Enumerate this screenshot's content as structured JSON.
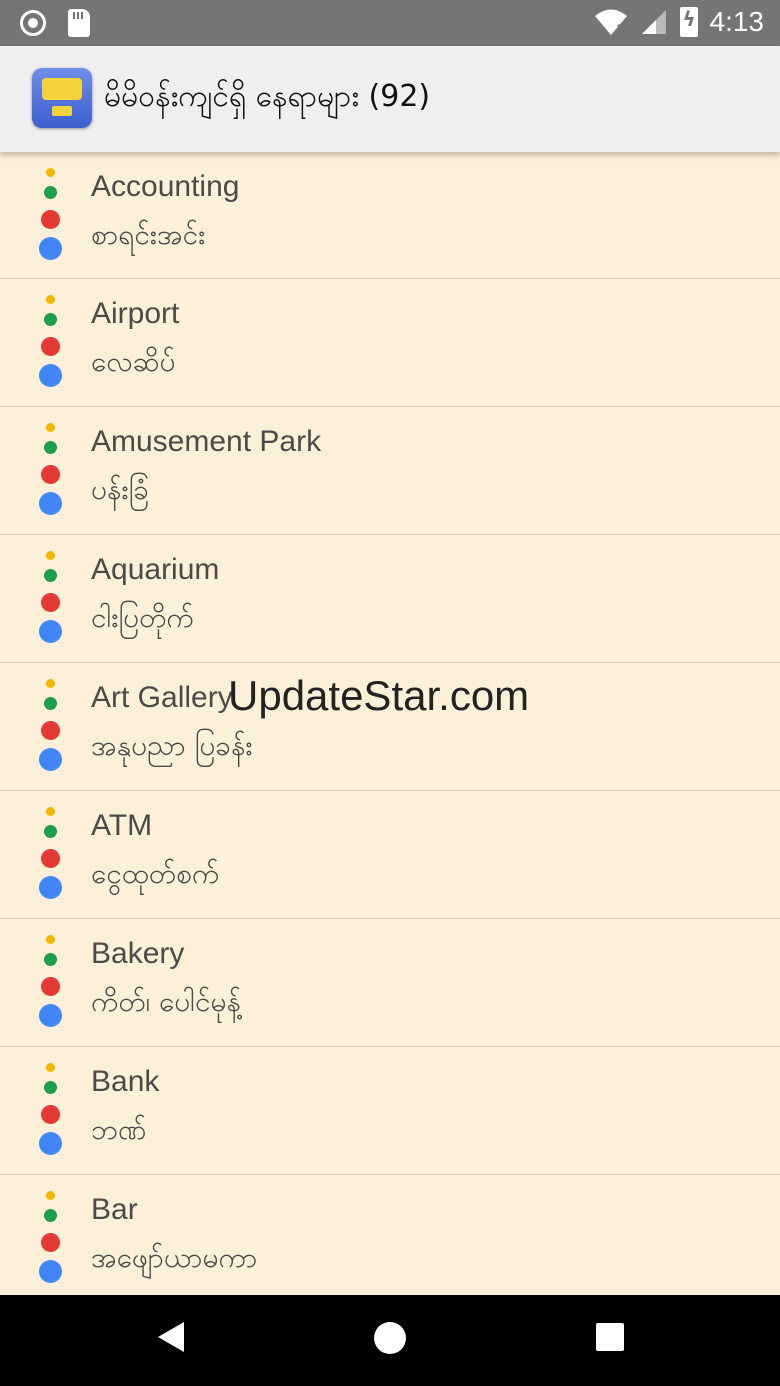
{
  "status_bar": {
    "time": "4:13"
  },
  "app_bar": {
    "title": "မိမိဝန်းကျင်ရှိ နေရာများ (92)"
  },
  "watermark": "UpdateStar.com",
  "places": [
    {
      "en": "Accounting",
      "my": "စာရင်းအင်း"
    },
    {
      "en": "Airport",
      "my": "လေဆိပ်"
    },
    {
      "en": "Amusement Park",
      "my": "ပန်းခြံ"
    },
    {
      "en": "Aquarium",
      "my": "ငါးပြတိုက်"
    },
    {
      "en": "Art Gallery",
      "my": "အနုပညာ ပြခန်း"
    },
    {
      "en": "ATM",
      "my": "ငွေထုတ်စက်"
    },
    {
      "en": "Bakery",
      "my": "ကိတ်၊ ပေါင်မုန့်"
    },
    {
      "en": "Bank",
      "my": "ဘဏ်"
    },
    {
      "en": "Bar",
      "my": "အဖျော်ယာမကာ"
    }
  ],
  "colors": {
    "dot_yellow": "#f4b400",
    "dot_green": "#1e9e4a",
    "dot_red": "#e53935",
    "dot_blue": "#4285f4",
    "list_background": "#fdf0d8"
  },
  "icons": [
    "radio-icon",
    "sd-card-icon",
    "wifi-icon",
    "signal-icon",
    "battery-charging-icon",
    "back-icon",
    "home-icon",
    "recents-icon"
  ]
}
